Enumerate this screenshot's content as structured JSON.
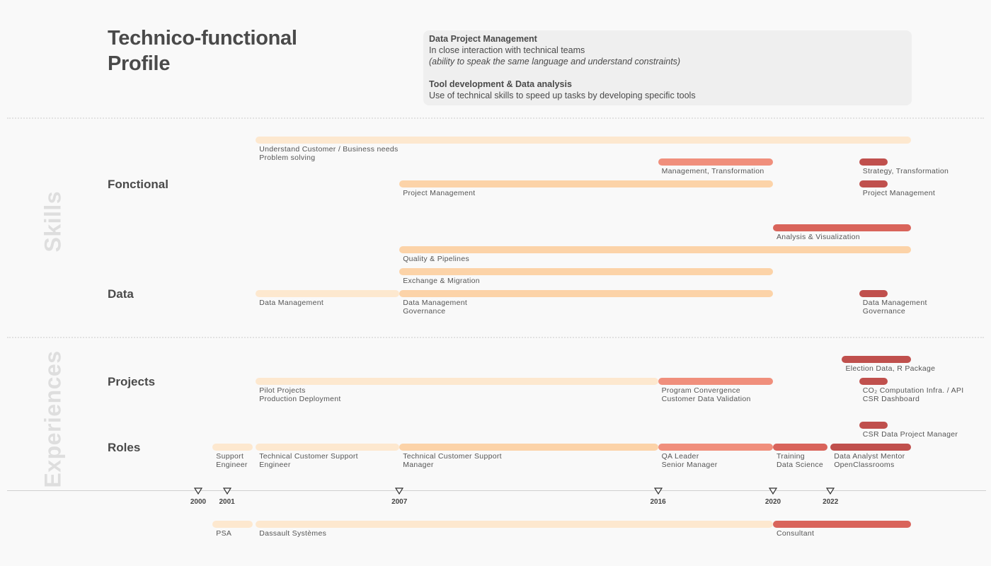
{
  "title": {
    "line1": "Technico-functional",
    "line2": "Profile"
  },
  "info": {
    "heading1": "Data Project Management",
    "line1": "In close interaction with technical teams",
    "line2": "(ability to speak the same language and understand constraints)",
    "heading2": "Tool development & Data analysis",
    "line3": "Use of technical skills to speed up tasks by developing specific tools"
  },
  "sections": {
    "skills": "Skills",
    "experiences": "Experiences"
  },
  "categories": {
    "fonctional": "Fonctional",
    "data": "Data",
    "projects": "Projects",
    "roles": "Roles"
  },
  "colors": {
    "pale": "#fde8cf",
    "light": "#fcd3a8",
    "salmon": "#f08f7c",
    "red": "#d9645b",
    "dark": "#c0504d"
  },
  "chart_data": {
    "type": "timeline",
    "axis": {
      "min": 1999.0,
      "max": 2026.0,
      "tick_years": [
        2000,
        2001,
        2007,
        2016,
        2020,
        2022
      ]
    },
    "bars": [
      {
        "group": "fonctional",
        "start": 2002.0,
        "end": 2024.8,
        "color": "pale",
        "label": [
          "Understand Customer / Business needs",
          "Problem solving"
        ]
      },
      {
        "group": "fonctional",
        "start": 2016.0,
        "end": 2020.0,
        "color": "salmon",
        "label": [
          "Management, Transformation"
        ]
      },
      {
        "group": "fonctional",
        "start": 2023.0,
        "end": 2024.0,
        "color": "dark",
        "label": [
          "Strategy, Transformation"
        ]
      },
      {
        "group": "fonctional",
        "start": 2007.0,
        "end": 2020.0,
        "color": "light",
        "label": [
          "Project Management"
        ]
      },
      {
        "group": "fonctional",
        "start": 2023.0,
        "end": 2024.0,
        "color": "dark",
        "label": [
          "Project Management"
        ]
      },
      {
        "group": "data",
        "start": 2020.0,
        "end": 2024.8,
        "color": "red",
        "label": [
          "Analysis & Visualization"
        ]
      },
      {
        "group": "data",
        "start": 2007.0,
        "end": 2024.8,
        "color": "light",
        "label": [
          "Quality & Pipelines"
        ]
      },
      {
        "group": "data",
        "start": 2007.0,
        "end": 2020.0,
        "color": "light",
        "label": [
          "Exchange & Migration"
        ]
      },
      {
        "group": "data",
        "start": 2002.0,
        "end": 2007.0,
        "color": "pale",
        "label": [
          "Data Management"
        ]
      },
      {
        "group": "data",
        "start": 2007.0,
        "end": 2020.0,
        "color": "light",
        "label": [
          "Data Management",
          "Governance"
        ]
      },
      {
        "group": "data",
        "start": 2023.0,
        "end": 2024.0,
        "color": "dark",
        "label": [
          "Data Management",
          "Governance"
        ]
      },
      {
        "group": "projects",
        "start": 2022.4,
        "end": 2024.8,
        "color": "dark",
        "label": [
          "Election Data, R Package"
        ]
      },
      {
        "group": "projects",
        "start": 2023.0,
        "end": 2024.0,
        "color": "dark",
        "label": [
          "CO₂ Computation Infra. / API",
          "CSR Dashboard"
        ]
      },
      {
        "group": "projects",
        "start": 2002.0,
        "end": 2016.0,
        "color": "pale",
        "label": [
          "Pilot Projects",
          "Production Deployment"
        ]
      },
      {
        "group": "projects",
        "start": 2016.0,
        "end": 2020.0,
        "color": "salmon",
        "label": [
          "Program Convergence",
          "Customer Data Validation"
        ]
      },
      {
        "group": "roles",
        "start": 2023.0,
        "end": 2024.0,
        "color": "dark",
        "label": [
          "CSR Data Project Manager"
        ]
      },
      {
        "group": "roles",
        "start": 2000.5,
        "end": 2001.9,
        "color": "pale",
        "label": [
          "Support",
          "Engineer"
        ]
      },
      {
        "group": "roles",
        "start": 2002.0,
        "end": 2007.0,
        "color": "pale",
        "label": [
          "Technical Customer Support",
          "Engineer"
        ]
      },
      {
        "group": "roles",
        "start": 2007.0,
        "end": 2016.0,
        "color": "light",
        "label": [
          "Technical Customer Support",
          "Manager"
        ]
      },
      {
        "group": "roles",
        "start": 2016.0,
        "end": 2020.0,
        "color": "salmon",
        "label": [
          "QA Leader",
          "Senior Manager"
        ]
      },
      {
        "group": "roles",
        "start": 2020.0,
        "end": 2021.9,
        "color": "red",
        "label": [
          "Training",
          "Data Science"
        ]
      },
      {
        "group": "roles",
        "start": 2022.0,
        "end": 2024.8,
        "color": "dark",
        "label": [
          "Data Analyst Mentor",
          "OpenClassrooms"
        ]
      },
      {
        "group": "companies",
        "start": 2000.5,
        "end": 2001.9,
        "color": "pale",
        "label": [
          "PSA"
        ]
      },
      {
        "group": "companies",
        "start": 2002.0,
        "end": 2020.0,
        "color": "pale",
        "label": [
          "Dassault Systèmes"
        ]
      },
      {
        "group": "companies",
        "start": 2020.0,
        "end": 2024.8,
        "color": "red",
        "label": [
          "Consultant"
        ]
      }
    ]
  }
}
